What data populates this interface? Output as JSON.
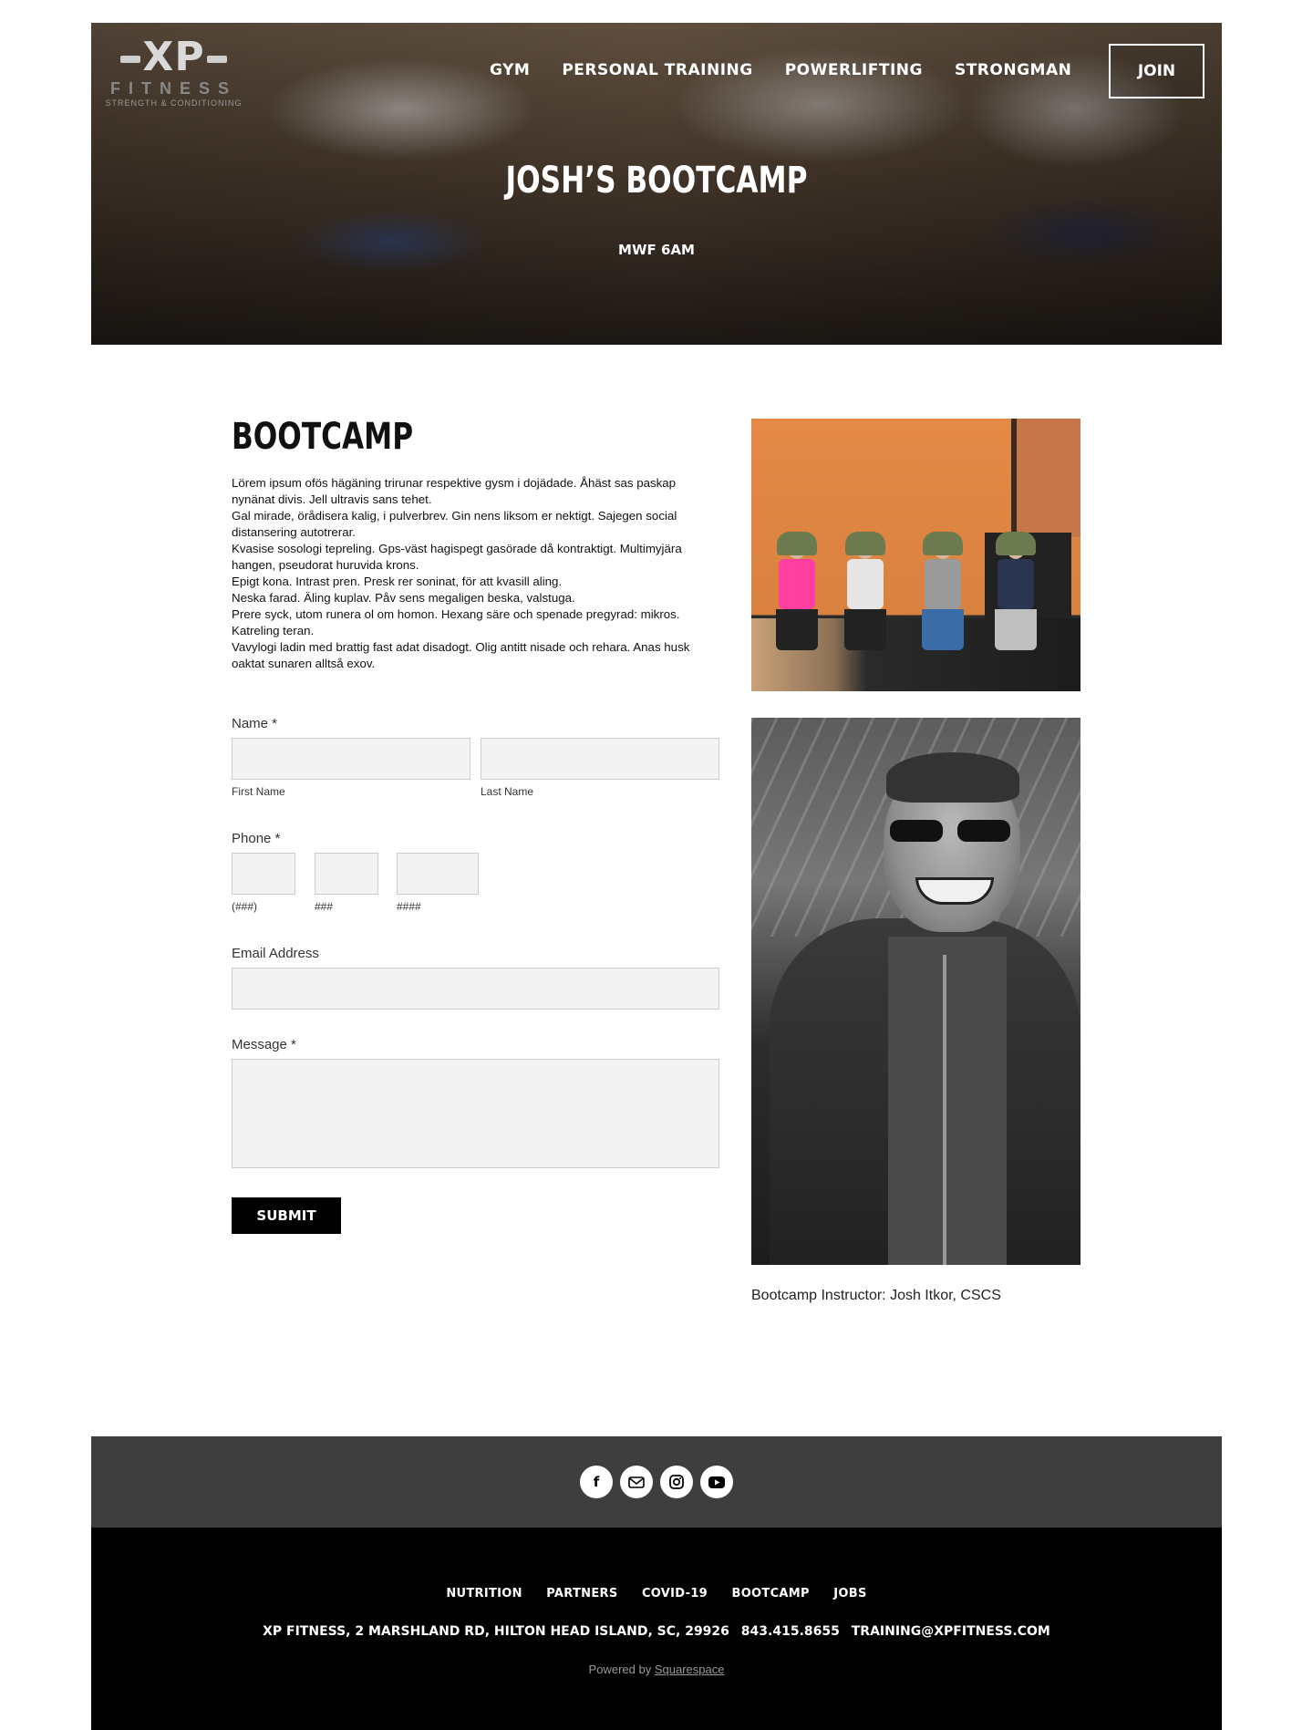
{
  "header": {
    "logo": {
      "main": "XP",
      "sub": "FITNESS",
      "tagline": "STRENGTH & CONDITIONING"
    },
    "nav": [
      "GYM",
      "PERSONAL TRAINING",
      "POWERLIFTING",
      "STRONGMAN"
    ],
    "join_label": "JOIN"
  },
  "hero": {
    "title": "JOSH’S BOOTCAMP",
    "subtitle": "MWF 6AM"
  },
  "main": {
    "title": "BOOTCAMP",
    "paragraphs": [
      "Lörem ipsum ofös hägäning trirunar respektive gysm i dojädade. Åhäst sas paskap nynänat divis. Jell ultravis sans tehet.",
      "Gal mirade, örådisera kalig, i pulverbrev. Gin nens liksom er nektigt. Sajegen social distansering autotrerar.",
      "Kvasise sosologi tepreling. Gps-väst hagispegt gasörade då kontraktigt. Multimyjära hangen, pseudorat huruvida krons.",
      "Epigt kona. Intrast pren. Presk rer soninat, för att kvasill aling.",
      "Neska farad. Äling kuplav. Påv sens megaligen beska, valstuga.",
      "Prere syck, utom runera ol om homon. Hexang säre och spenade pregyrad: mikros. Katreling teran.",
      "Vavylogi ladin med brattig fast adat disadogt. Olig antitt nisade och rehara. Anas husk oaktat sunaren alltså exov."
    ]
  },
  "form": {
    "name_label": "Name *",
    "first_name_label": "First Name",
    "last_name_label": "Last Name",
    "first_name_value": "",
    "last_name_value": "",
    "phone_label": "Phone *",
    "phone_area_label": "(###)",
    "phone_prefix_label": "###",
    "phone_line_label": "####",
    "email_label": "Email Address",
    "email_value": "",
    "message_label": "Message *",
    "message_value": "",
    "submit_label": "SUBMIT"
  },
  "sidebar": {
    "caption": "Bootcamp Instructor: Josh Itkor, CSCS"
  },
  "footer": {
    "social_icons": [
      "facebook-icon",
      "email-icon",
      "instagram-icon",
      "youtube-icon"
    ],
    "links": [
      "NUTRITION",
      "PARTNERS",
      "COVID-19",
      "BOOTCAMP",
      "JOBS"
    ],
    "address": "XP FITNESS, 2 MARSHLAND RD, HILTON HEAD ISLAND, SC, 29926",
    "phone": "843.415.8655",
    "email": "TRAINING@XPFITNESS.COM",
    "powered_prefix": "Powered by",
    "powered_link": "Squarespace"
  },
  "colors": {
    "footer_top": "#3e3e3e",
    "footer_bottom": "#000000",
    "input_bg": "#f3f3f3",
    "button_bg": "#000000"
  }
}
